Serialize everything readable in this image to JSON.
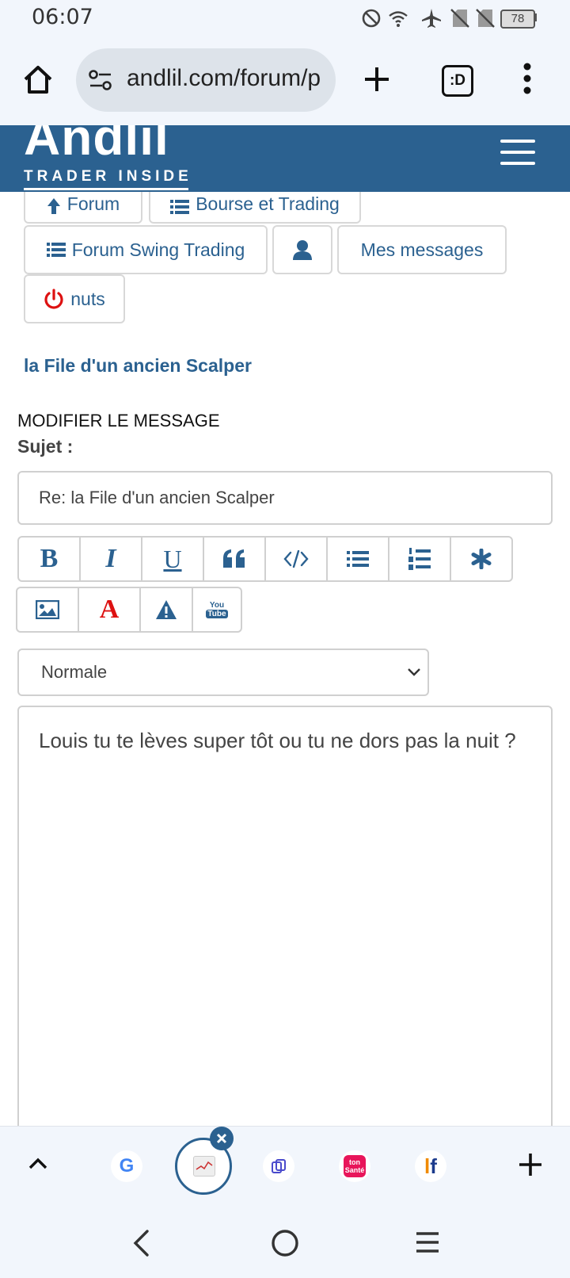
{
  "status": {
    "time": "06:07",
    "battery": "78"
  },
  "browser": {
    "url": "andlil.com/forum/p",
    "tab_switcher_label": ":D"
  },
  "site": {
    "logo": "Andlil",
    "tagline": "TRADER INSIDE"
  },
  "nav": {
    "forum": "Forum",
    "bourse": "Bourse et Trading",
    "swing": "Forum Swing Trading",
    "messages": "Mes messages",
    "user": "nuts"
  },
  "thread_title": "la File d'un ancien Scalper",
  "editor": {
    "heading": "MODIFIER LE MESSAGE",
    "subject_label": "Sujet :",
    "subject_value": "Re: la File d'un ancien Scalper",
    "size_selected": "Normale",
    "message": "Louis tu te lèves super tôt ou tu ne dors pas la nuit ?",
    "toolbar_row1": [
      "bold-icon",
      "italic-icon",
      "underline-icon",
      "quote-icon",
      "code-icon",
      "bullet-list-icon",
      "numbered-list-icon",
      "asterisk-icon"
    ],
    "toolbar_row2": [
      "image-icon",
      "font-color-icon",
      "warning-icon",
      "youtube-icon"
    ],
    "bold_glyph": "B",
    "italic_glyph": "I",
    "underline_glyph": "U",
    "fontcolor_glyph": "A",
    "youtube_top": "You",
    "youtube_bottom": "Tube"
  },
  "tabs_bar": {
    "chips": [
      "google-icon",
      "active-tab-thumbnail",
      "perplexity-icon",
      "ton-sante-icon",
      "lf-icon"
    ],
    "sante_label": "ton Santé",
    "lf_l": "l",
    "lf_f": "f",
    "google_g": "G"
  },
  "colors": {
    "brand_blue": "#2b6190",
    "red_accent": "#dd1111",
    "chrome_bg": "#f2f6fc"
  }
}
